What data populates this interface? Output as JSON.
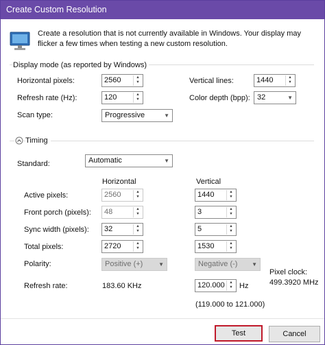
{
  "window": {
    "title": "Create Custom Resolution"
  },
  "intro": "Create a resolution that is not currently available in Windows. Your display may flicker a few times when testing a new custom resolution.",
  "display_mode": {
    "legend": "Display mode (as reported by Windows)",
    "horizontal_pixels": {
      "label": "Horizontal pixels:",
      "value": "2560"
    },
    "vertical_lines": {
      "label": "Vertical lines:",
      "value": "1440"
    },
    "refresh_rate": {
      "label": "Refresh rate (Hz):",
      "value": "120"
    },
    "color_depth": {
      "label": "Color depth (bpp):",
      "value": "32"
    },
    "scan_type": {
      "label": "Scan type:",
      "value": "Progressive"
    }
  },
  "timing": {
    "legend": "Timing",
    "standard": {
      "label": "Standard:",
      "value": "Automatic"
    },
    "col_horizontal": "Horizontal",
    "col_vertical": "Vertical",
    "rows": [
      {
        "label": "Active pixels:",
        "h": "2560",
        "v": "1440"
      },
      {
        "label": "Front porch (pixels):",
        "h": "48",
        "v": "3"
      },
      {
        "label": "Sync width (pixels):",
        "h": "32",
        "v": "5"
      },
      {
        "label": "Total pixels:",
        "h": "2720",
        "v": "1530"
      }
    ],
    "polarity": {
      "label": "Polarity:",
      "h": "Positive (+)",
      "v": "Negative (-)"
    },
    "refresh": {
      "label": "Refresh rate:",
      "h": "183.60 KHz",
      "v": "120.000",
      "unit": "Hz",
      "range": "(119.000 to 121.000)"
    },
    "pixel_clock": {
      "label": "Pixel clock:",
      "value": "499.3920 MHz"
    }
  },
  "buttons": {
    "test": "Test",
    "cancel": "Cancel"
  },
  "icons": {
    "monitor": "monitor-icon",
    "collapse": "collapse-icon"
  },
  "colors": {
    "titlebar": "#6a4aa8",
    "test_border": "#c0192a"
  }
}
